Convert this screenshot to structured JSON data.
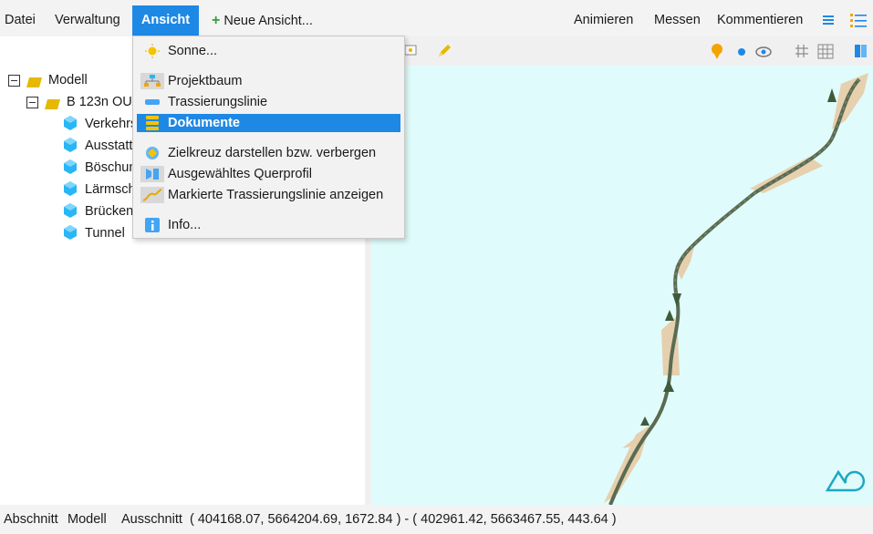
{
  "menubar": {
    "datei": "Datei",
    "verwaltung": "Verwaltung",
    "ansicht": "Ansicht",
    "neue_ansicht": "Neue Ansicht...",
    "animieren": "Animieren",
    "messen": "Messen",
    "kommentieren": "Kommentieren"
  },
  "tree": {
    "root": "Modell",
    "project": "B 123n OU",
    "children": [
      "Verkehrs",
      "Ausstatt",
      "Böschun",
      "Lärmsch",
      "Brücken",
      "Tunnel"
    ]
  },
  "dropdown": {
    "items": [
      {
        "label": "Sonne...",
        "icon": "sun-icon"
      },
      {
        "label": "Projektbaum",
        "icon": "project-tree-icon"
      },
      {
        "label": "Trassierungslinie",
        "icon": "alignment-line-icon"
      },
      {
        "label": "Dokumente",
        "icon": "documents-icon",
        "selected": true
      },
      {
        "label": "Zielkreuz darstellen bzw. verbergen",
        "icon": "crosshair-icon"
      },
      {
        "label": "Ausgewähltes Querprofil",
        "icon": "cross-section-icon"
      },
      {
        "label": "Markierte Trassierungslinie anzeigen",
        "icon": "marked-alignment-icon"
      },
      {
        "label": "Info...",
        "icon": "info-icon"
      }
    ]
  },
  "statusbar": {
    "abschnitt_label": "Abschnitt",
    "abschnitt_value": "Modell",
    "ausschnitt_label": "Ausschnitt",
    "ausschnitt_value": "( 404168.07, 5664204.69, 1672.84 ) - ( 402961.42, 5663467.55, 443.64 )"
  },
  "colors": {
    "accent": "#1e88e5",
    "viewport_background": "#e0fbfb",
    "cube": "#29b6f6",
    "folder": "#e6b800"
  }
}
